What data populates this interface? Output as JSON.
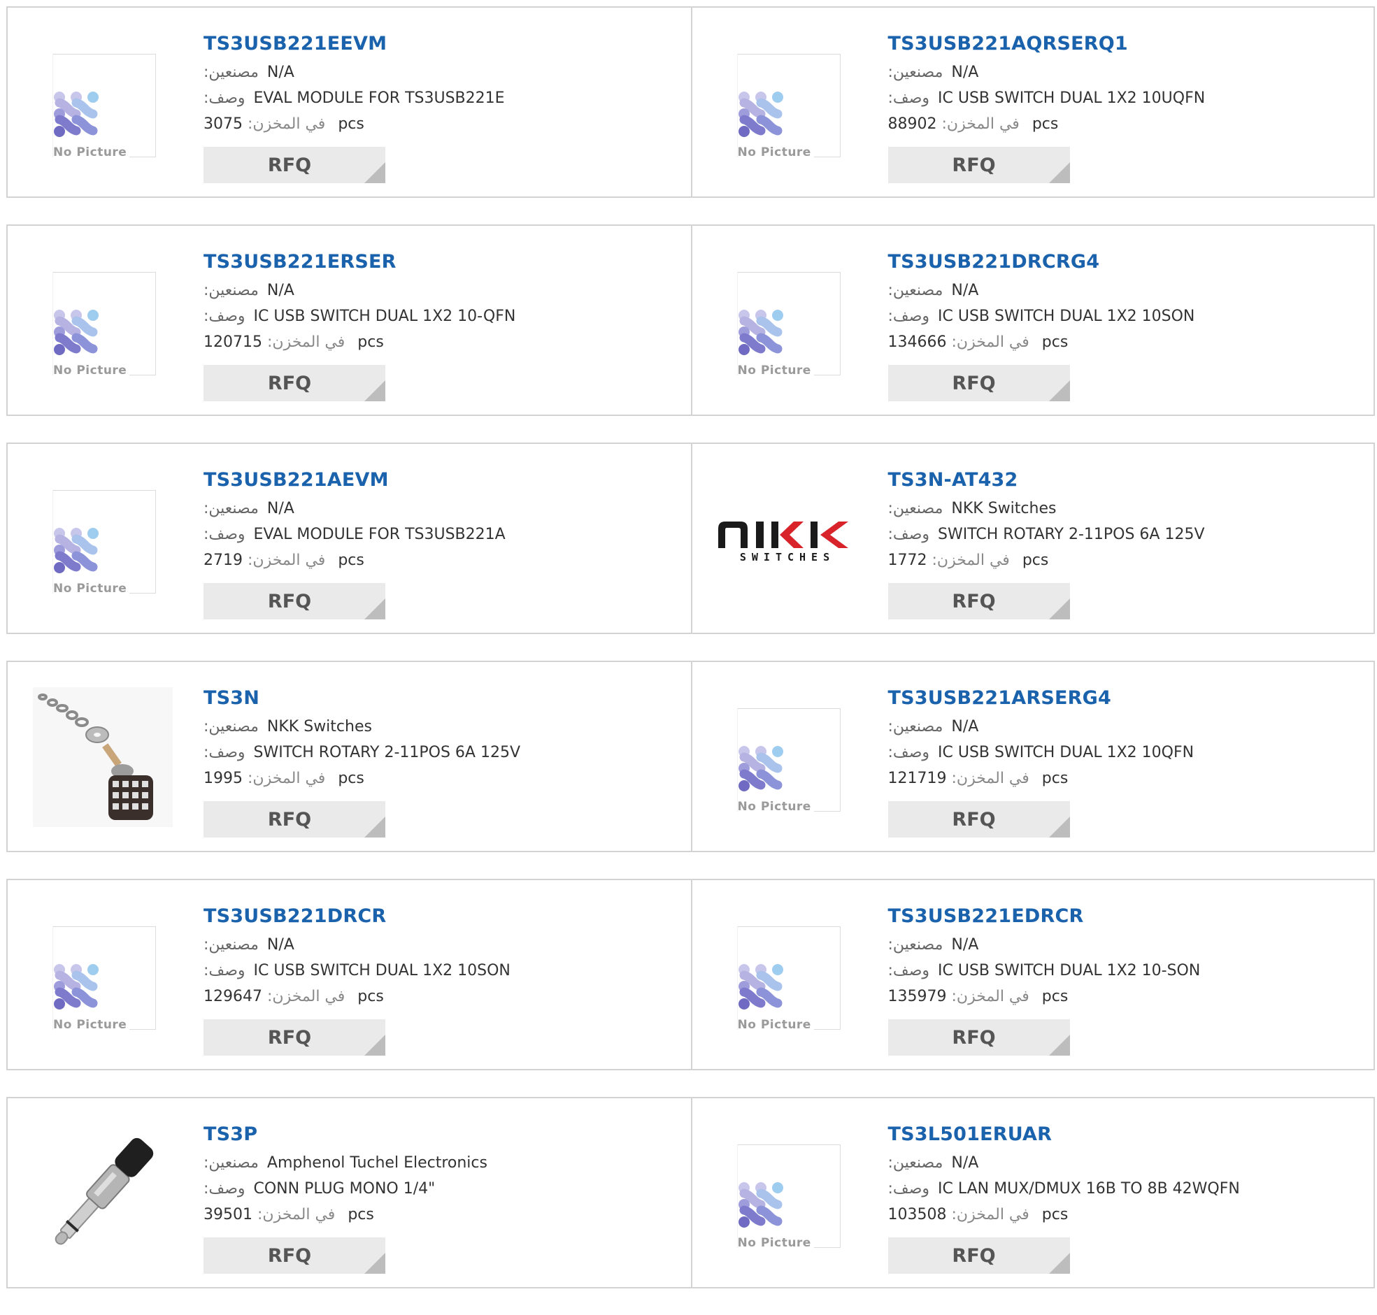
{
  "labels": {
    "manufacturer": ":مصنعين",
    "description": ":وصف",
    "stock": ":في المخزن",
    "pcs": "pcs",
    "rfq": "RFQ",
    "no_picture": "No Picture"
  },
  "colors": {
    "link": "#1b62ad",
    "border": "#d3d3d3",
    "button_bg": "#eaeaea"
  },
  "products": [
    {
      "part": "TS3USB221EEVM",
      "manufacturer": "N/A",
      "description": "EVAL MODULE FOR TS3USB221E",
      "stock": "3075",
      "image": "no-picture"
    },
    {
      "part": "TS3USB221AQRSERQ1",
      "manufacturer": "N/A",
      "description": "IC USB SWITCH DUAL 1X2 10UQFN",
      "stock": "88902",
      "image": "no-picture"
    },
    {
      "part": "TS3USB221ERSER",
      "manufacturer": "N/A",
      "description": "IC USB SWITCH DUAL 1X2 10-QFN",
      "stock": "120715",
      "image": "no-picture"
    },
    {
      "part": "TS3USB221DRCRG4",
      "manufacturer": "N/A",
      "description": "IC USB SWITCH DUAL 1X2 10SON",
      "stock": "134666",
      "image": "no-picture"
    },
    {
      "part": "TS3USB221AEVM",
      "manufacturer": "N/A",
      "description": "EVAL MODULE FOR TS3USB221A",
      "stock": "2719",
      "image": "no-picture"
    },
    {
      "part": "TS3N-AT432",
      "manufacturer": "NKK Switches",
      "description": "SWITCH ROTARY 2-11POS 6A 125V",
      "stock": "1772",
      "image": "nkk-logo"
    },
    {
      "part": "TS3N",
      "manufacturer": "NKK Switches",
      "description": "SWITCH ROTARY 2-11POS 6A 125V",
      "stock": "1995",
      "image": "rotary-switch"
    },
    {
      "part": "TS3USB221ARSERG4",
      "manufacturer": "N/A",
      "description": "IC USB SWITCH DUAL 1X2 10QFN",
      "stock": "121719",
      "image": "no-picture"
    },
    {
      "part": "TS3USB221DRCR",
      "manufacturer": "N/A",
      "description": "IC USB SWITCH DUAL 1X2 10SON",
      "stock": "129647",
      "image": "no-picture"
    },
    {
      "part": "TS3USB221EDRCR",
      "manufacturer": "N/A",
      "description": "IC USB SWITCH DUAL 1X2 10-SON",
      "stock": "135979",
      "image": "no-picture"
    },
    {
      "part": "TS3P",
      "manufacturer": "Amphenol Tuchel Electronics",
      "description": "CONN PLUG MONO 1/4\"",
      "stock": "39501",
      "image": "audio-plug"
    },
    {
      "part": "TS3L501ERUAR",
      "manufacturer": "N/A",
      "description": "IC LAN MUX/DMUX 16B TO 8B 42WQFN",
      "stock": "103508",
      "image": "no-picture"
    }
  ]
}
